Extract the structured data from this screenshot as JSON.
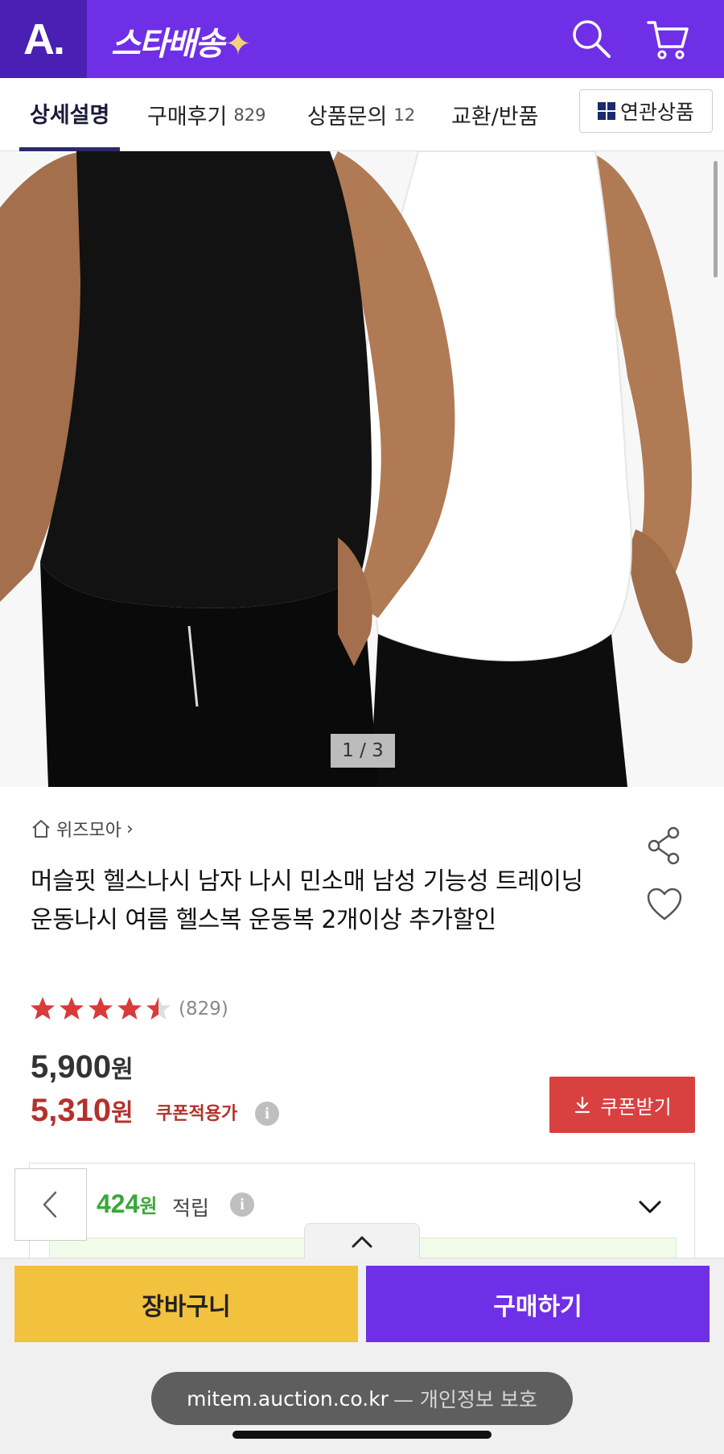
{
  "header": {
    "logo": "A.",
    "brand": "스타배송",
    "brand_star": "✦",
    "icons": [
      "search-icon",
      "cart-icon"
    ],
    "accent_color": "#6f2fe6",
    "logo_bg_color": "#4a1fb3"
  },
  "tabs": [
    {
      "label": "상세설명",
      "count": "",
      "active": true
    },
    {
      "label": "구매후기",
      "count": "829",
      "active": false
    },
    {
      "label": "상품문의",
      "count": "12",
      "active": false
    },
    {
      "label": "교환/반품",
      "count": "",
      "active": false
    }
  ],
  "related_button": {
    "label": "연관상품",
    "icon": "grid-icon"
  },
  "image": {
    "pager": "1 / 3"
  },
  "product": {
    "shop_name": "위즈모아",
    "shop_chevron": "›",
    "title": "머슬핏 헬스나시 남자 나시 민소매 남성 기능성 트레이닝 운동나시 여름 헬스복 운동복 2개이상 추가할인",
    "rating": 4.5,
    "review_count": "(829)",
    "price_original": "5,900",
    "price_sale": "5,310",
    "currency": "원",
    "coupon_price_label": "쿠폰적용가",
    "coupon_button": "쿠폰받기",
    "points_amount": "424",
    "points_label": "적립",
    "info_mark": "i",
    "sale_color": "#b5312c",
    "points_color": "#3aa83a"
  },
  "bottom": {
    "cart_label": "장바구니",
    "buy_label": "구매하기",
    "cart_color": "#f2c13d",
    "buy_color": "#6f2fe6"
  },
  "browser": {
    "url": "mitem.auction.co.kr",
    "url_suffix": "— 개인정보 보호"
  }
}
